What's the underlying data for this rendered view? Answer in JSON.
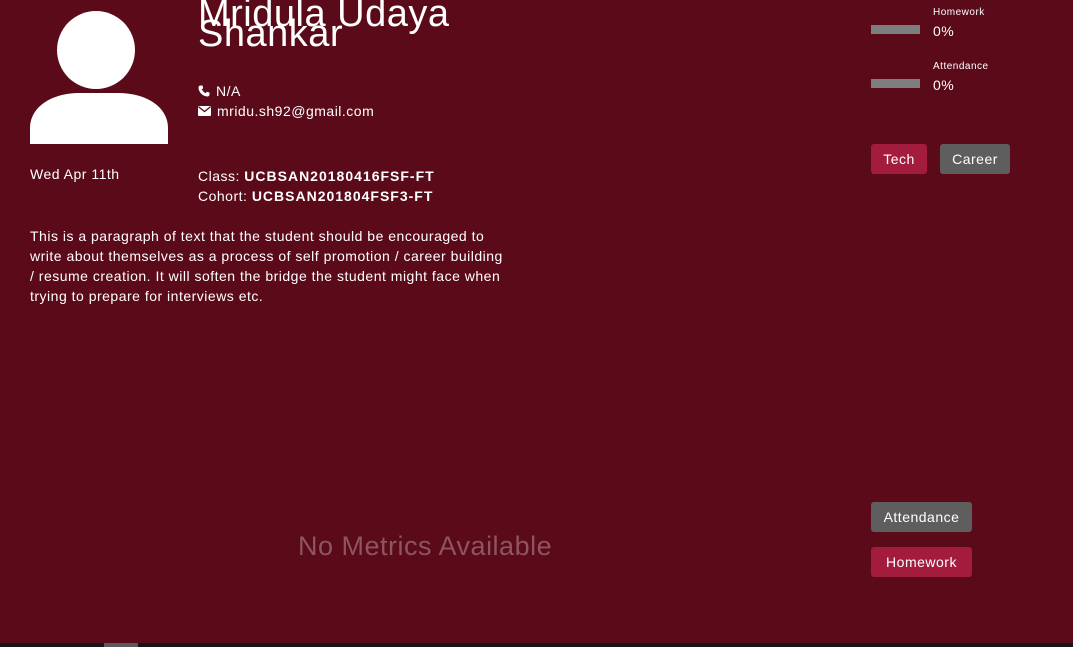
{
  "profile": {
    "name": "Mridula Udaya Shankar",
    "phone": "N/A",
    "email": "mridu.sh92@gmail.com",
    "date": "Wed Apr 11th",
    "class_label": "Class:",
    "class_value": "UCBSAN20180416FSF-FT",
    "cohort_label": "Cohort:",
    "cohort_value": "UCBSAN201804FSF3-FT",
    "bio": "This is a paragraph of text that the student should be encouraged to write about themselves as a process of self promotion / career building / resume creation. It will soften the bridge the student might face when trying to prepare for interviews etc."
  },
  "stats": {
    "homework": {
      "label": "Homework",
      "value": "0%",
      "fraction": 0
    },
    "attendance": {
      "label": "Attendance",
      "value": "0%",
      "fraction": 0
    }
  },
  "buttons": {
    "tech": "Tech",
    "career": "Career",
    "attendance": "Attendance",
    "homework": "Homework"
  },
  "metrics": {
    "empty_text": "No Metrics Available"
  },
  "icons": {
    "avatar": "user-silhouette-icon",
    "phone": "phone-icon",
    "email": "envelope-icon"
  },
  "colors": {
    "background": "#5a0a18",
    "accent": "#a31c3e",
    "neutral_button": "#5e5e5e",
    "bar": "#7d7d7d"
  }
}
